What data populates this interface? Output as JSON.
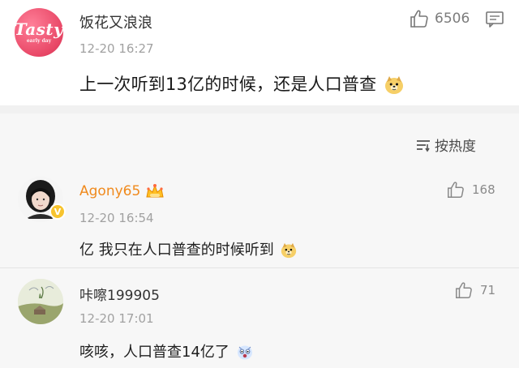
{
  "main_post": {
    "username": "饭花又浪浪",
    "avatar_text": "Tasty",
    "avatar_subtext": "early day",
    "time": "12-20 16:27",
    "text": "上一次听到13亿的时候，还是人口普查",
    "likes": "6506"
  },
  "sort": {
    "label": "按热度"
  },
  "comments": [
    {
      "username": "Agony65",
      "time": "12-20 16:54",
      "text": "亿 我只在人口普查的时候听到",
      "likes": "168"
    },
    {
      "username": "咔嚓199905",
      "time": "12-20 17:01",
      "text": "咳咳，人口普查14亿了",
      "likes": "71"
    }
  ],
  "colors": {
    "accent_orange": "#f08a1d",
    "secondary_text": "#a1a1a1",
    "background_gray": "#f7f7f7"
  }
}
